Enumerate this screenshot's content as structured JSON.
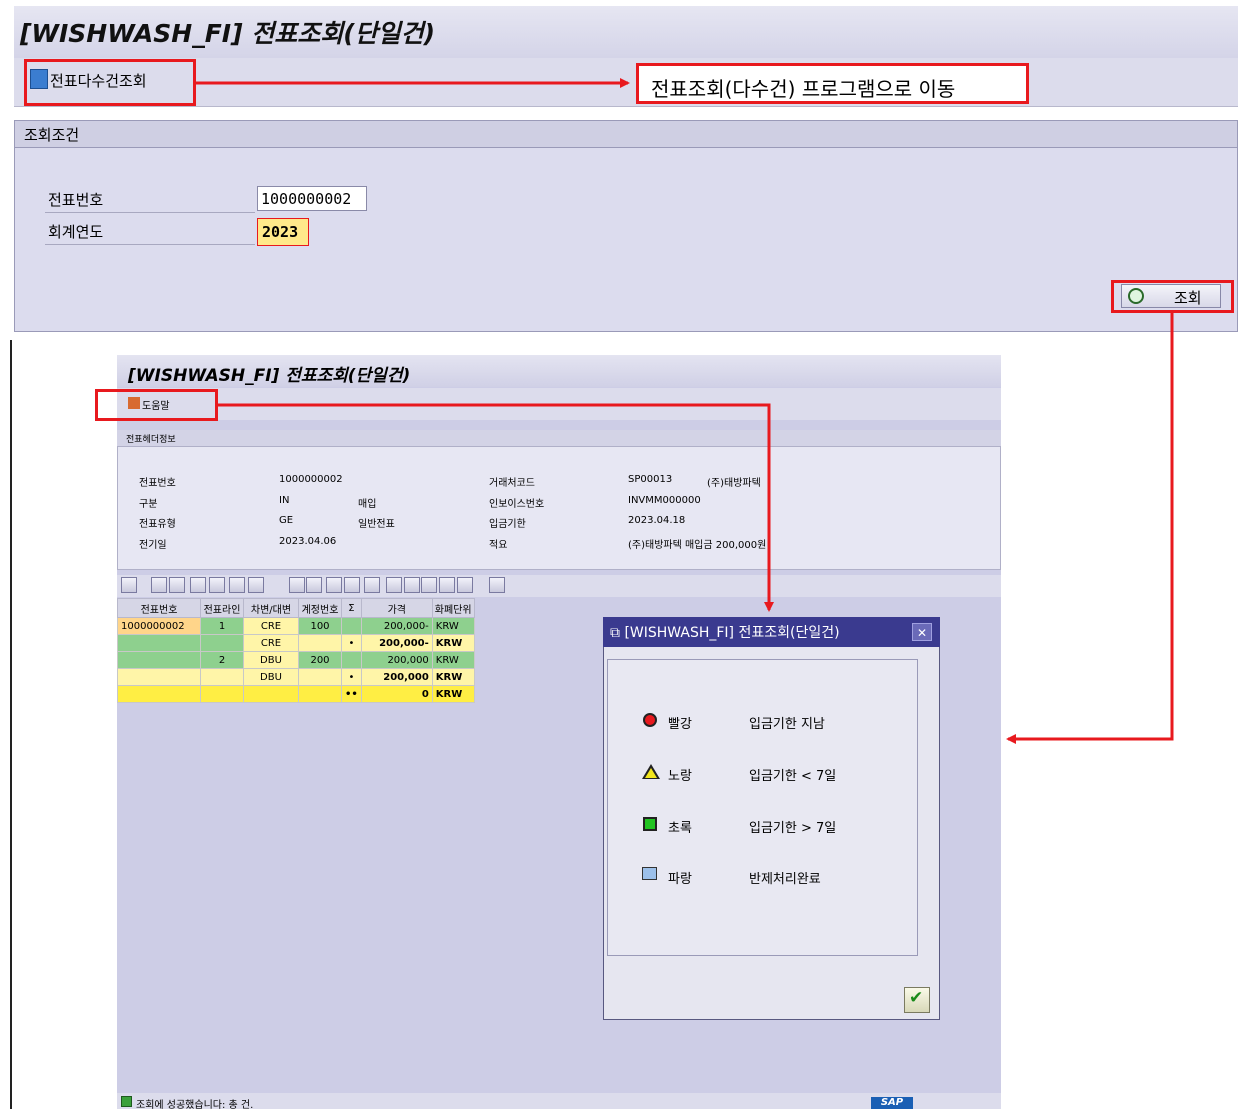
{
  "main": {
    "title": "[WISHWASH_FI] 전표조회(단일건)",
    "toolbar": {
      "multi_button_label": "전표다수건조회"
    },
    "annotation": "전표조회(다수건) 프로그램으로 이동",
    "panel_header": "조회조건",
    "fields": {
      "doc_no_label": "전표번호",
      "doc_no_value": "1000000002",
      "year_label": "회계연도",
      "year_value": "2023"
    },
    "search_button_label": "조회"
  },
  "sub": {
    "title": "[WISHWASH_FI] 전표조회(단일건)",
    "help_label": "도움말",
    "header_panel_label": "전표헤더정보",
    "header_left": [
      {
        "label": "전표번호",
        "value": "1000000002",
        "desc": ""
      },
      {
        "label": "구분",
        "value": "IN",
        "desc": "매입"
      },
      {
        "label": "전표유형",
        "value": "GE",
        "desc": "일반전표"
      },
      {
        "label": "전기일",
        "value": "2023.04.06",
        "desc": ""
      }
    ],
    "header_right": [
      {
        "label": "거래처코드",
        "value": "SP00013",
        "desc": "(주)태방파텍"
      },
      {
        "label": "인보이스번호",
        "value": "INVMM000000",
        "desc": ""
      },
      {
        "label": "입금기한",
        "value": "2023.04.18",
        "desc": ""
      },
      {
        "label": "적요",
        "value": "(주)태방파텍 매입금 200,000원",
        "desc": ""
      }
    ],
    "grid": {
      "columns": [
        "전표번호",
        "전표라인",
        "차변/대변",
        "계정번호",
        "Σ",
        "가격",
        "화폐단위"
      ],
      "rows": [
        [
          "1000000002",
          "1",
          "CRE",
          "100",
          "",
          "200,000-",
          "KRW"
        ],
        [
          "",
          "",
          "CRE",
          "",
          "•",
          "200,000-",
          "KRW"
        ],
        [
          "",
          "2",
          "DBU",
          "200",
          "",
          "200,000",
          "KRW"
        ],
        [
          "",
          "",
          "DBU",
          "",
          "•",
          "200,000",
          "KRW"
        ],
        [
          "",
          "",
          "",
          "",
          "••",
          "0",
          "KRW"
        ]
      ]
    },
    "status": "조회에 성공했습니다: 총 건.",
    "sap_logo": "SAP"
  },
  "legend": {
    "title": "[WISHWASH_FI] 전표조회(단일건)",
    "items": [
      {
        "color_name": "빨강",
        "description": "입금기한 지남",
        "color": "#e8191e",
        "icon": "red-light-icon"
      },
      {
        "color_name": "노랑",
        "description": "입금기한 < 7일",
        "color": "#f3e61c",
        "icon": "yellow-triangle-icon"
      },
      {
        "color_name": "초록",
        "description": "입금기한 > 7일",
        "color": "#22c422",
        "icon": "green-square-icon"
      },
      {
        "color_name": "파랑",
        "description": "반제처리완료",
        "color": "#9cc0ea",
        "icon": "blue-clipboard-icon"
      }
    ]
  },
  "colors": {
    "annotation_red": "#e8191e",
    "sap_window": "#cdcde6",
    "popup_title": "#3a3a8f"
  }
}
